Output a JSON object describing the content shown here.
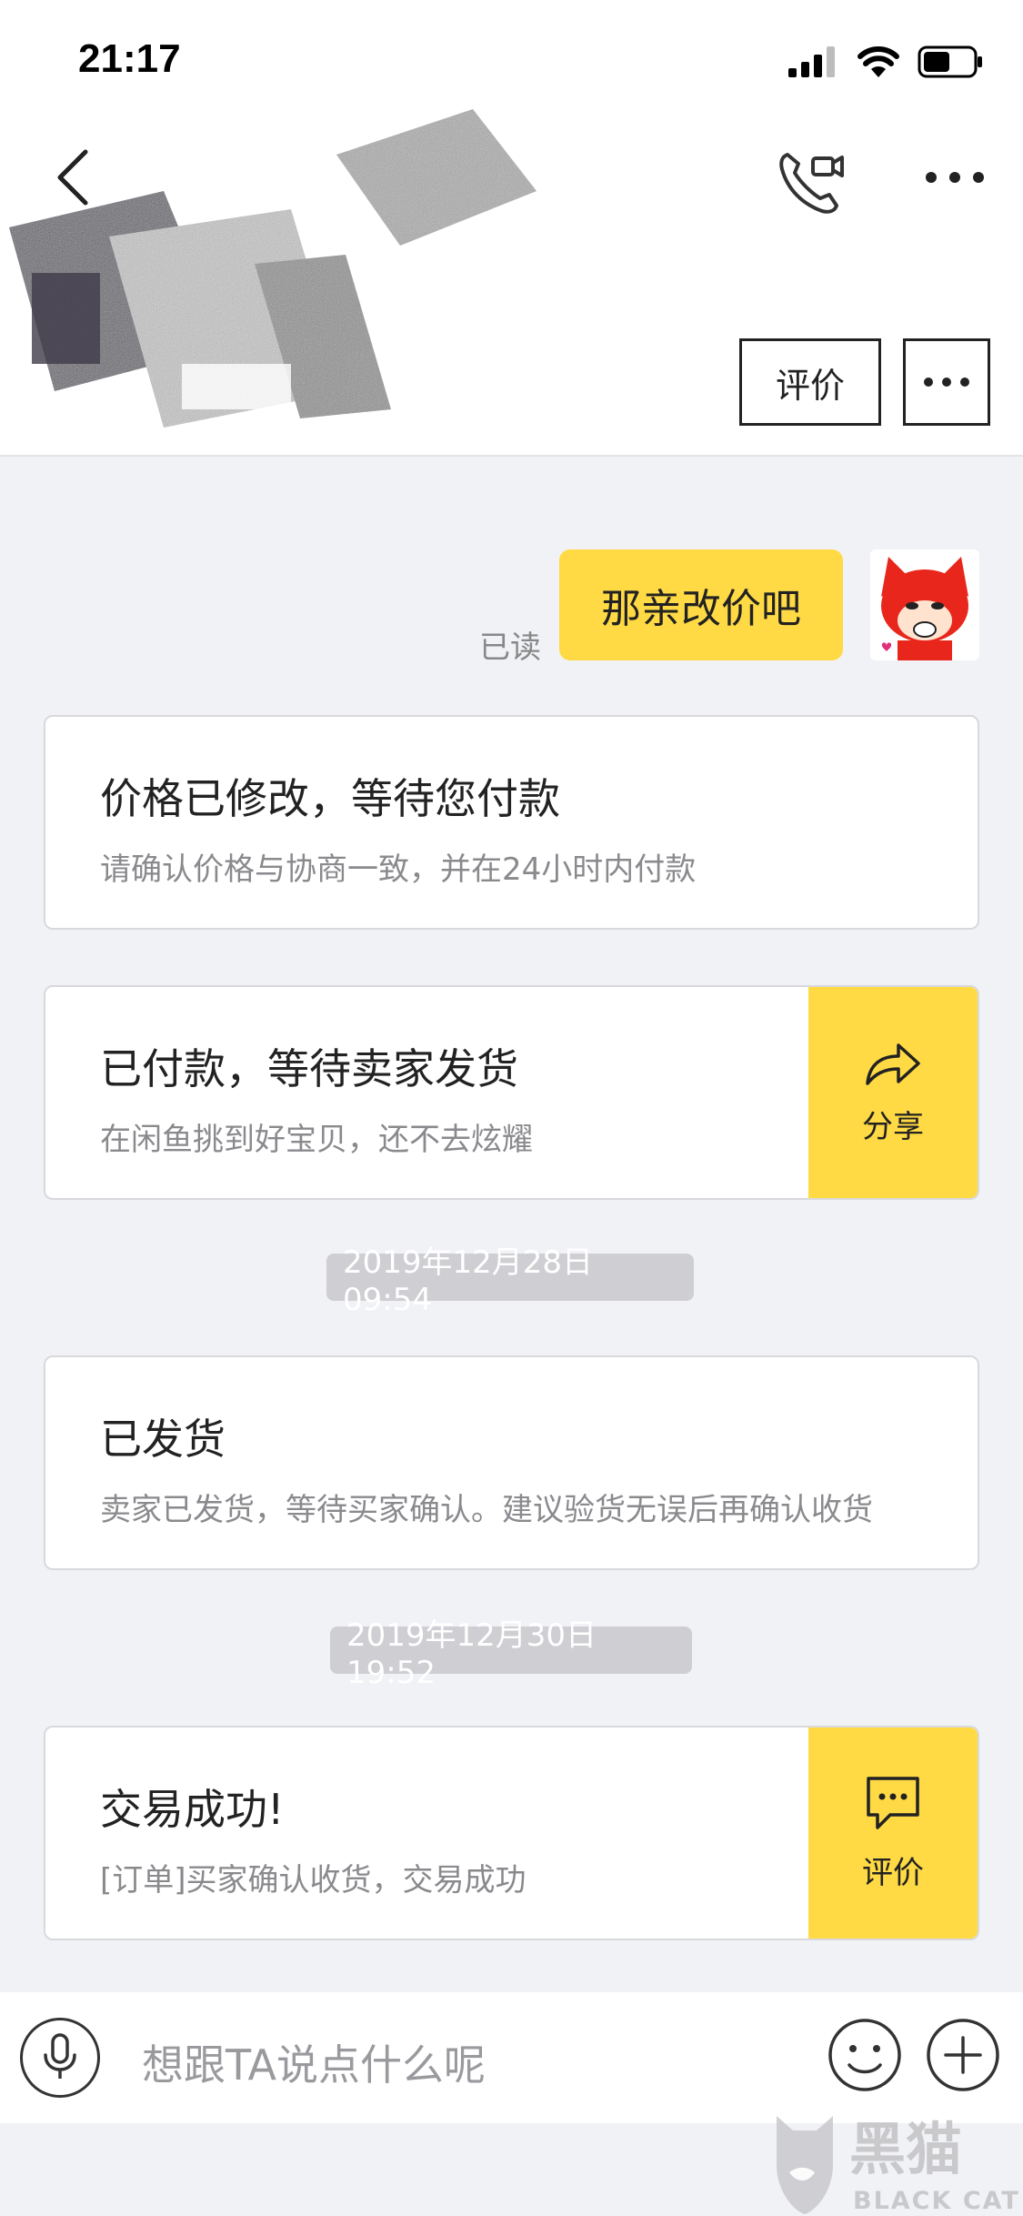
{
  "status_bar": {
    "time": "21:17"
  },
  "header": {
    "rate_button": "评价",
    "more_button": "···"
  },
  "chat": {
    "message": "那亲改价吧",
    "read_status": "已读"
  },
  "cards": [
    {
      "title": "价格已修改，等待您付款",
      "subtitle": "请确认价格与协商一致，并在24小时内付款"
    },
    {
      "title": "已付款，等待卖家发货",
      "subtitle": "在闲鱼挑到好宝贝，还不去炫耀",
      "action_label": "分享",
      "action_icon": "share-icon"
    },
    {
      "title": "已发货",
      "subtitle": "卖家已发货，等待买家确认。建议验货无误后再确认收货"
    },
    {
      "title": "交易成功!",
      "subtitle": "[订单]买家确认收货，交易成功",
      "action_label": "评价",
      "action_icon": "comment-icon"
    }
  ],
  "timestamps": [
    "2019年12月28日 09:54",
    "2019年12月30日 19:52"
  ],
  "input_bar": {
    "placeholder": "想跟TA说点什么呢"
  },
  "watermark": {
    "cn": "黑猫",
    "en": "BLACK CAT"
  },
  "colors": {
    "accent": "#ffda44",
    "background": "#f1f2f6"
  }
}
